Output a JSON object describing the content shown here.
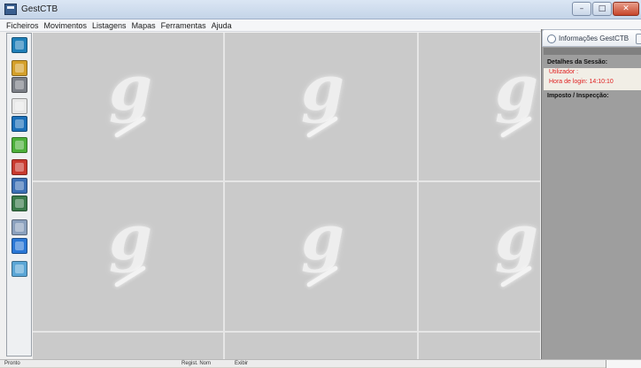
{
  "window": {
    "title": "GestCTB"
  },
  "menu": {
    "items": [
      "Ficheiros",
      "Movimentos",
      "Listagens",
      "Mapas",
      "Ferramentas",
      "Ajuda"
    ]
  },
  "toolbar": {
    "buttons": [
      {
        "name": "pencil-icon",
        "color": "#1f7fb8"
      },
      {
        "name": "book-icon",
        "color": "#d4a02a"
      },
      {
        "name": "notebook-icon",
        "color": "#7b7f86"
      },
      {
        "name": "edit-document-icon",
        "color": "#e8e8e8"
      },
      {
        "name": "pen-icon",
        "color": "#1b6fb8"
      },
      {
        "name": "checkmark-icon",
        "color": "#4caf3a"
      },
      {
        "name": "red-book-icon",
        "color": "#c83a2e"
      },
      {
        "name": "blue-book-icon",
        "color": "#3b6fb4"
      },
      {
        "name": "green-book-icon",
        "color": "#3a7a4a"
      },
      {
        "name": "tools-icon",
        "color": "#8aa0bd"
      },
      {
        "name": "help-icon",
        "color": "#2b78d6"
      },
      {
        "name": "exit-icon",
        "color": "#5aa6d6"
      }
    ]
  },
  "info_panel": {
    "title": "Informações GestCTB",
    "session_label": "Detalhes da Sessão:",
    "user_label": "Utilizador :",
    "login_time": "Hora de login: 14:10:10",
    "tax_label": "Imposto / Inspecção:"
  },
  "statusbar": {
    "left": "Pronto",
    "center": "Regist. Nom",
    "right": "Exibir"
  },
  "colors": {
    "workspace": "#cacaca",
    "session_text": "#e02020"
  }
}
